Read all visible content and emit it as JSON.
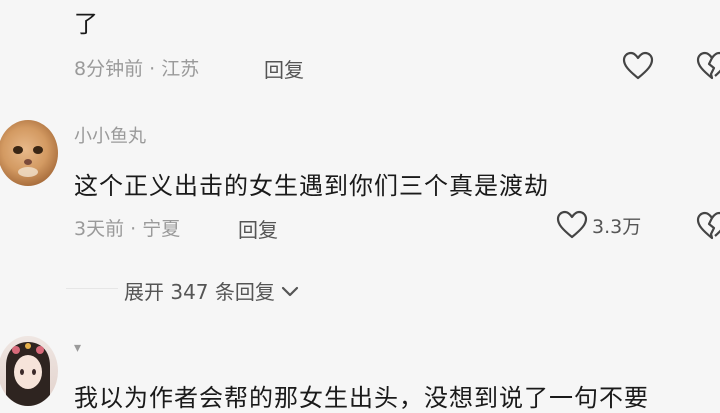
{
  "comment_prev": {
    "text_tail": "了",
    "meta": "8分钟前 · 江苏",
    "reply_label": "回复"
  },
  "comment_1": {
    "username": "小小鱼丸",
    "text": "这个正义出击的女生遇到你们三个真是渡劫",
    "meta": "3天前 · 宁夏",
    "reply_label": "回复",
    "like_count": "3.3万",
    "expand_label": "展开 347 条回复"
  },
  "comment_2": {
    "username": "▾",
    "text": "我以为作者会帮的那女生出头，没想到说了一句不要"
  },
  "icons": {
    "like": "heart-outline-icon",
    "dislike": "broken-heart-icon",
    "expand": "chevron-down-icon"
  },
  "colors": {
    "background": "#f6f6f6",
    "meta_text": "#9a9a9a",
    "main_text": "#1a1a1a"
  }
}
